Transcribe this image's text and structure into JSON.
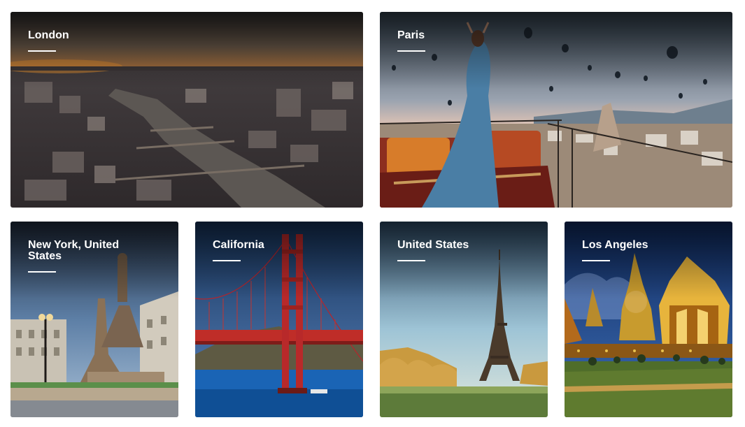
{
  "destinations": [
    {
      "title": "London",
      "image": "london-aerial-river-image"
    },
    {
      "title": "Paris",
      "image": "woman-hot-air-balloons-image"
    },
    {
      "title": "New York, United States",
      "image": "statue-monument-image"
    },
    {
      "title": "California",
      "image": "golden-gate-bridge-image"
    },
    {
      "title": "United States",
      "image": "eiffel-tower-image"
    },
    {
      "title": "Los Angeles",
      "image": "golden-temple-image"
    }
  ]
}
